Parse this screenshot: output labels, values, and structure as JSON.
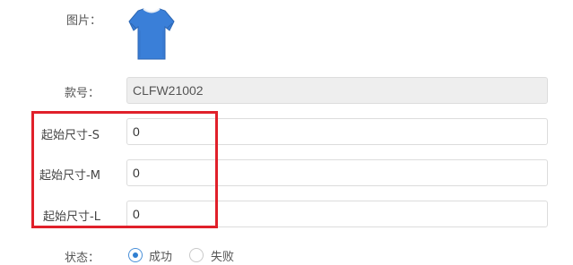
{
  "form": {
    "image_label": "图片：",
    "style_no_label": "款号：",
    "style_no_value": "CLFW21002",
    "size_s_label": "起始尺寸-S",
    "size_s_value": "0",
    "size_m_label": "起始尺寸-M",
    "size_m_value": "0",
    "size_l_label": "起始尺寸-L",
    "size_l_value": "0",
    "status_label": "状态：",
    "status_options": {
      "success": "成功",
      "fail": "失败"
    },
    "status_selected": "成功"
  },
  "icons": {
    "product_image": "tshirt-image",
    "radio_selected": "radio-checked-icon",
    "radio_unselected": "radio-unchecked-icon"
  },
  "colors": {
    "highlight": "#e0202a",
    "radio_accent": "#2f7fd1",
    "tshirt": "#3a7fd8"
  }
}
